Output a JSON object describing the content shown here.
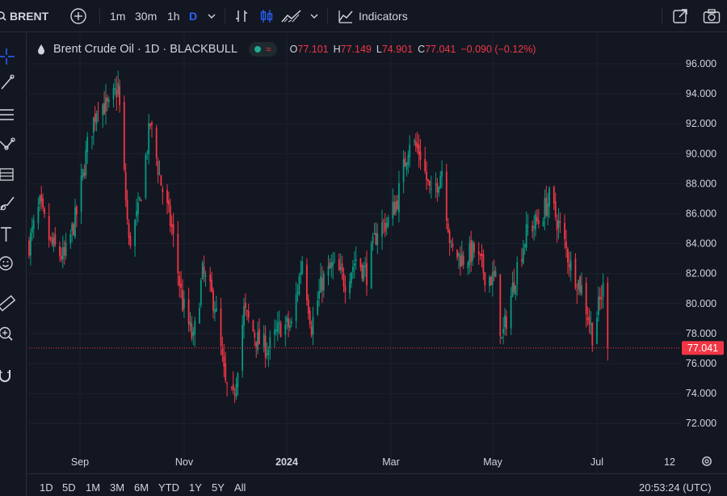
{
  "toolbar": {
    "symbol": "BRENT",
    "intervals": [
      "1m",
      "30m",
      "1h",
      "D"
    ],
    "active_interval": "D",
    "indicators_label": "Indicators"
  },
  "legend": {
    "title": "Brent Crude Oil · 1D · BLACKBULL",
    "open_key": "O",
    "open": "77.101",
    "high_key": "H",
    "high": "77.149",
    "low_key": "L",
    "low": "74.901",
    "close_key": "C",
    "close": "77.041",
    "change": "−0.090 (−0.12%)"
  },
  "price_label": "77.041",
  "ranges": [
    "1D",
    "5D",
    "1M",
    "3M",
    "6M",
    "YTD",
    "1Y",
    "5Y",
    "All"
  ],
  "clock": "20:53:24 (UTC)",
  "colors": {
    "up": "#089981",
    "down": "#f23645",
    "bg": "#131722",
    "grid": "#1e222d"
  },
  "chart_data": {
    "type": "candlestick",
    "symbol": "Brent Crude Oil",
    "interval": "1D",
    "ylim": [
      71.5,
      96.5
    ],
    "y_ticks": [
      "96.000",
      "94.000",
      "92.000",
      "90.000",
      "88.000",
      "86.000",
      "84.000",
      "82.000",
      "80.000",
      "78.000",
      "76.000",
      "74.000",
      "72.000"
    ],
    "x_ticks": [
      "Sep",
      "Nov",
      "2024",
      "Mar",
      "May",
      "Jul",
      "12"
    ],
    "last_price": 77.041,
    "close_path": [
      {
        "date": "2023-08-01",
        "close": 84.0
      },
      {
        "date": "2023-08-08",
        "close": 86.5
      },
      {
        "date": "2023-08-15",
        "close": 84.0
      },
      {
        "date": "2023-08-24",
        "close": 83.0
      },
      {
        "date": "2023-09-01",
        "close": 86.0
      },
      {
        "date": "2023-09-08",
        "close": 90.5
      },
      {
        "date": "2023-09-15",
        "close": 93.5
      },
      {
        "date": "2023-09-22",
        "close": 93.0
      },
      {
        "date": "2023-09-28",
        "close": 94.5
      },
      {
        "date": "2023-10-05",
        "close": 84.0
      },
      {
        "date": "2023-10-11",
        "close": 86.0
      },
      {
        "date": "2023-10-19",
        "close": 92.0
      },
      {
        "date": "2023-10-26",
        "close": 88.0
      },
      {
        "date": "2023-11-02",
        "close": 85.0
      },
      {
        "date": "2023-11-09",
        "close": 80.0
      },
      {
        "date": "2023-11-16",
        "close": 77.5
      },
      {
        "date": "2023-11-22",
        "close": 82.0
      },
      {
        "date": "2023-11-30",
        "close": 80.0
      },
      {
        "date": "2023-12-07",
        "close": 74.5
      },
      {
        "date": "2023-12-12",
        "close": 73.5
      },
      {
        "date": "2023-12-19",
        "close": 79.5
      },
      {
        "date": "2023-12-28",
        "close": 77.5
      },
      {
        "date": "2024-01-04",
        "close": 77.0
      },
      {
        "date": "2024-01-12",
        "close": 78.5
      },
      {
        "date": "2024-01-19",
        "close": 78.5
      },
      {
        "date": "2024-01-26",
        "close": 83.0
      },
      {
        "date": "2024-02-01",
        "close": 78.5
      },
      {
        "date": "2024-02-08",
        "close": 81.5
      },
      {
        "date": "2024-02-15",
        "close": 82.5
      },
      {
        "date": "2024-02-23",
        "close": 81.5
      },
      {
        "date": "2024-03-01",
        "close": 83.0
      },
      {
        "date": "2024-03-08",
        "close": 82.0
      },
      {
        "date": "2024-03-15",
        "close": 85.0
      },
      {
        "date": "2024-03-22",
        "close": 85.5
      },
      {
        "date": "2024-03-28",
        "close": 87.0
      },
      {
        "date": "2024-04-05",
        "close": 91.0
      },
      {
        "date": "2024-04-12",
        "close": 90.0
      },
      {
        "date": "2024-04-19",
        "close": 87.0
      },
      {
        "date": "2024-04-26",
        "close": 89.0
      },
      {
        "date": "2024-05-02",
        "close": 83.5
      },
      {
        "date": "2024-05-10",
        "close": 83.0
      },
      {
        "date": "2024-05-17",
        "close": 83.5
      },
      {
        "date": "2024-05-24",
        "close": 82.0
      },
      {
        "date": "2024-05-31",
        "close": 81.5
      },
      {
        "date": "2024-06-04",
        "close": 77.5
      },
      {
        "date": "2024-06-14",
        "close": 82.5
      },
      {
        "date": "2024-06-21",
        "close": 85.0
      },
      {
        "date": "2024-06-28",
        "close": 85.5
      },
      {
        "date": "2024-07-05",
        "close": 87.0
      },
      {
        "date": "2024-07-12",
        "close": 85.0
      },
      {
        "date": "2024-07-19",
        "close": 82.5
      },
      {
        "date": "2024-07-26",
        "close": 81.0
      },
      {
        "date": "2024-08-02",
        "close": 78.0
      },
      {
        "date": "2024-08-09",
        "close": 81.0
      },
      {
        "date": "2024-08-12",
        "close": 77.04
      }
    ]
  }
}
